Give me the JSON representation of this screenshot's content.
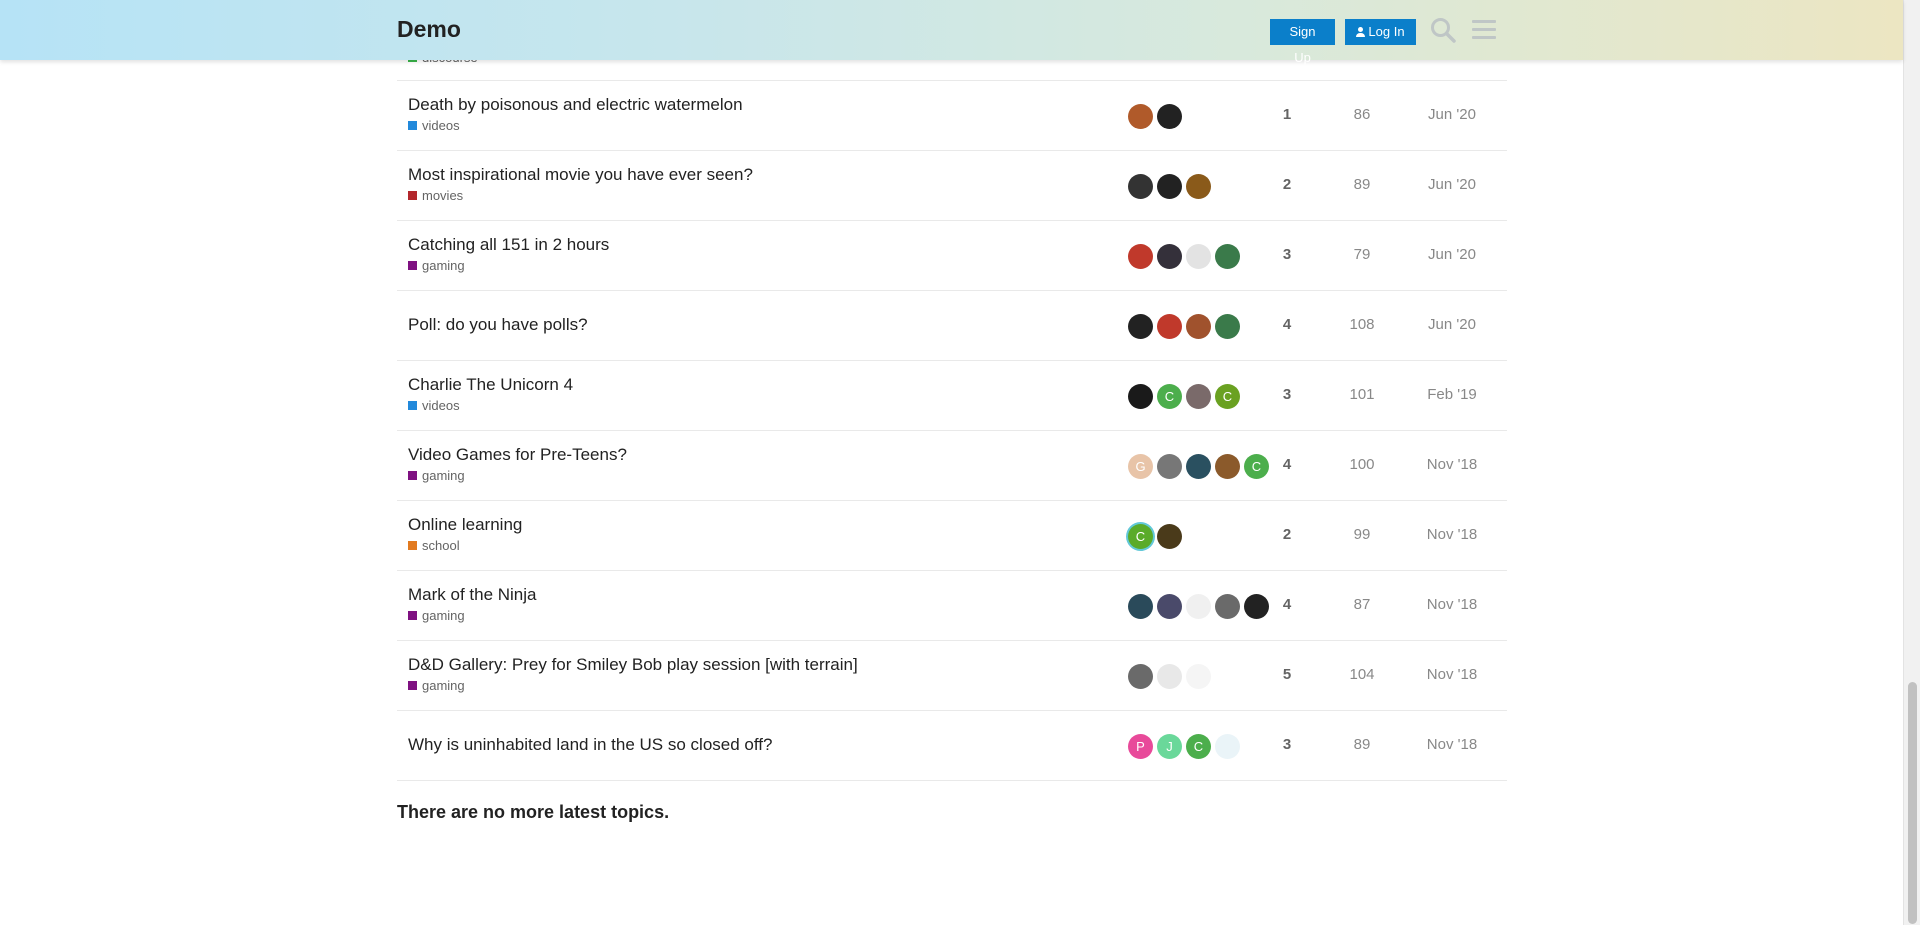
{
  "header": {
    "site_name": "Demo",
    "signup_label": "Sign Up",
    "login_label": "Log In",
    "search_icon": "search-icon",
    "menu_icon": "hamburger-menu-icon"
  },
  "partial_category": "discourse",
  "topics": [
    {
      "title": "Death by poisonous and electric watermelon",
      "category": "videos",
      "cat_color": "#2289db",
      "posters": [
        {
          "color": "#b05a2a",
          "letter": ""
        },
        {
          "color": "#222222",
          "letter": ""
        }
      ],
      "replies": "1",
      "views": "86",
      "activity": "Jun '20"
    },
    {
      "title": "Most inspirational movie you have ever seen?",
      "category": "movies",
      "cat_color": "#b3272c",
      "posters": [
        {
          "color": "#333333",
          "letter": ""
        },
        {
          "color": "#222222",
          "letter": ""
        },
        {
          "color": "#8a5a1a",
          "letter": ""
        }
      ],
      "replies": "2",
      "views": "89",
      "activity": "Jun '20"
    },
    {
      "title": "Catching all 151 in 2 hours",
      "category": "gaming",
      "cat_color": "#7f1181",
      "posters": [
        {
          "color": "#c0392b",
          "letter": ""
        },
        {
          "color": "#34303a",
          "letter": ""
        },
        {
          "color": "#e3e3e3",
          "letter": ""
        },
        {
          "color": "#3a7a4a",
          "letter": ""
        }
      ],
      "replies": "3",
      "views": "79",
      "activity": "Jun '20"
    },
    {
      "title": "Poll: do you have polls?",
      "category": "",
      "cat_color": "",
      "posters": [
        {
          "color": "#222222",
          "letter": ""
        },
        {
          "color": "#c0392b",
          "letter": ""
        },
        {
          "color": "#a0522d",
          "letter": ""
        },
        {
          "color": "#3a7a4a",
          "letter": ""
        }
      ],
      "replies": "4",
      "views": "108",
      "activity": "Jun '20"
    },
    {
      "title": "Charlie The Unicorn 4",
      "category": "videos",
      "cat_color": "#2289db",
      "posters": [
        {
          "color": "#1a1a1a",
          "letter": ""
        },
        {
          "color": "#4cae4c",
          "letter": "C"
        },
        {
          "color": "#7a6a6a",
          "letter": ""
        },
        {
          "color": "#6aa121",
          "letter": "C"
        }
      ],
      "replies": "3",
      "views": "101",
      "activity": "Feb '19"
    },
    {
      "title": "Video Games for Pre-Teens?",
      "category": "gaming",
      "cat_color": "#7f1181",
      "posters": [
        {
          "color": "#e8c4a8",
          "letter": "G"
        },
        {
          "color": "#777777",
          "letter": ""
        },
        {
          "color": "#2a5060",
          "letter": ""
        },
        {
          "color": "#8b5a2b",
          "letter": ""
        },
        {
          "color": "#4cae4c",
          "letter": "C"
        }
      ],
      "replies": "4",
      "views": "100",
      "activity": "Nov '18"
    },
    {
      "title": "Online learning",
      "category": "school",
      "cat_color": "#e27a1f",
      "posters": [
        {
          "color": "#5aab2a",
          "letter": "C"
        },
        {
          "color": "#4a3a1a",
          "letter": ""
        }
      ],
      "replies": "2",
      "views": "99",
      "activity": "Nov '18"
    },
    {
      "title": "Mark of the Ninja",
      "category": "gaming",
      "cat_color": "#7f1181",
      "posters": [
        {
          "color": "#2a4a5a",
          "letter": ""
        },
        {
          "color": "#4a4a6a",
          "letter": ""
        },
        {
          "color": "#f0f0f0",
          "letter": ""
        },
        {
          "color": "#6a6a6a",
          "letter": ""
        },
        {
          "color": "#222222",
          "letter": ""
        }
      ],
      "replies": "4",
      "views": "87",
      "activity": "Nov '18"
    },
    {
      "title": "D&D Gallery: Prey for Smiley Bob play session [with terrain]",
      "category": "gaming",
      "cat_color": "#7f1181",
      "posters": [
        {
          "color": "#6a6a6a",
          "letter": ""
        },
        {
          "color": "#e8e8e8",
          "letter": ""
        },
        {
          "color": "#f5f5f5",
          "letter": ""
        }
      ],
      "replies": "5",
      "views": "104",
      "activity": "Nov '18"
    },
    {
      "title": "Why is uninhabited land in the US so closed off?",
      "category": "",
      "cat_color": "",
      "posters": [
        {
          "color": "#e84a9a",
          "letter": "P"
        },
        {
          "color": "#6ad89a",
          "letter": "J"
        },
        {
          "color": "#4cae4c",
          "letter": "C"
        },
        {
          "color": "#eaf4f8",
          "letter": ""
        }
      ],
      "replies": "3",
      "views": "89",
      "activity": "Nov '18"
    }
  ],
  "footer_message": "There are no more latest topics."
}
